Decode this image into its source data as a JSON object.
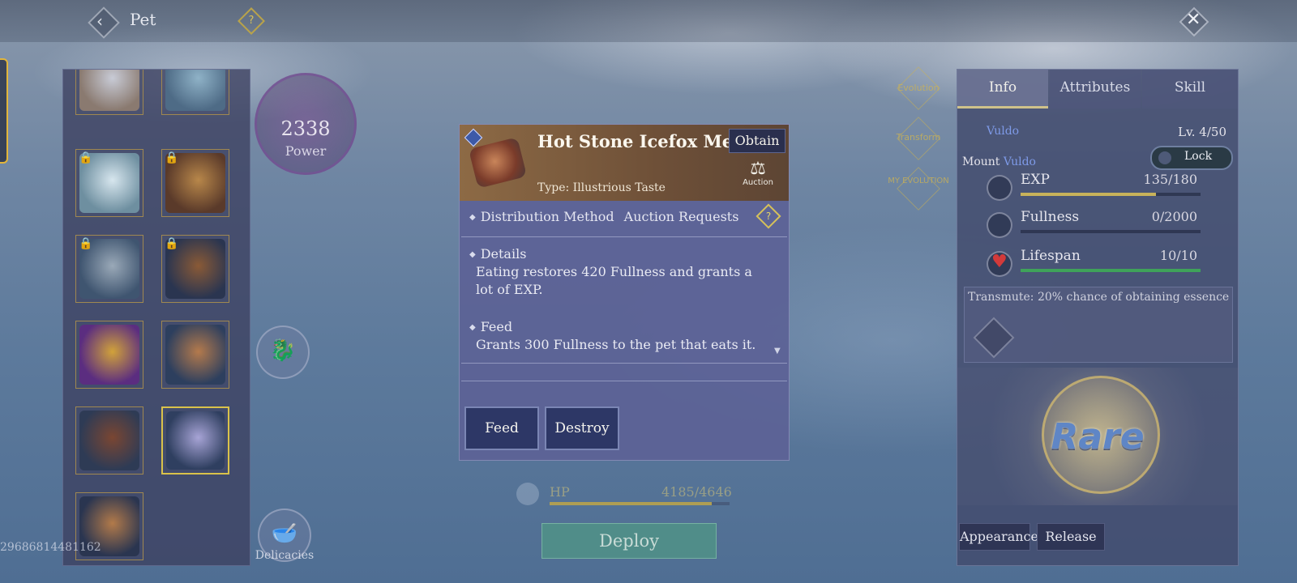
{
  "header": {
    "title": "Pet",
    "help": "?",
    "back_icon": "back-arrow-icon",
    "close_icon": "close-icon"
  },
  "power": {
    "value": "2338",
    "label": "Power"
  },
  "pet_list": {
    "slots": [
      {
        "id": "pet-1",
        "colors": [
          "#8a7a70",
          "#c8cbd6"
        ],
        "locked": false
      },
      {
        "id": "pet-2",
        "colors": [
          "#4e6b86",
          "#8fb2c7"
        ],
        "locked": false
      },
      {
        "id": "pet-3",
        "colors": [
          "#6e8fa0",
          "#d7e6ee"
        ],
        "locked": true
      },
      {
        "id": "pet-4",
        "colors": [
          "#5a3a2a",
          "#b8874a"
        ],
        "locked": true
      },
      {
        "id": "pet-5",
        "colors": [
          "#3f5570",
          "#9aa9b8"
        ],
        "locked": true
      },
      {
        "id": "pet-6",
        "colors": [
          "#2a3550",
          "#8a5a36"
        ],
        "locked": true
      },
      {
        "id": "pet-7",
        "colors": [
          "#5b2d80",
          "#d1a23a"
        ],
        "locked": false
      },
      {
        "id": "pet-8",
        "colors": [
          "#2d3f5e",
          "#b47a4c"
        ],
        "locked": false
      },
      {
        "id": "pet-9",
        "colors": [
          "#2e3b55",
          "#7a4632"
        ],
        "locked": false
      },
      {
        "id": "pet-10",
        "colors": [
          "#2f3f60",
          "#a7a4d6"
        ],
        "locked": false,
        "selected": true
      },
      {
        "id": "pet-11",
        "colors": [
          "#2a3550",
          "#b27a4a"
        ],
        "locked": false
      }
    ]
  },
  "delicacies": {
    "label": "Delicacies"
  },
  "item": {
    "name": "Hot Stone Icefox Meat",
    "obtain_label": "Obtain",
    "auction_label": "Auction",
    "type_text": "Type: Illustrious Taste",
    "distribution_label": "Distribution Method",
    "distribution_value": "Auction Requests",
    "details_title": "Details",
    "details_body": "Eating restores 420 Fullness and grants a lot of EXP.",
    "feed_title": "Feed",
    "feed_body": "Grants 300 Fullness to the pet that eats it.",
    "feed_button": "Feed",
    "destroy_button": "Destroy"
  },
  "hp": {
    "label": "HP",
    "value": "4185/4646",
    "ratio": 0.901
  },
  "deploy": {
    "label": "Deploy"
  },
  "side_actions": {
    "evolution": "Evolution",
    "transform": "Transform",
    "my_evolution": "MY EVOLUTION"
  },
  "right_panel": {
    "tabs": [
      "Info",
      "Attributes",
      "Skill"
    ],
    "active_tab": 0,
    "mount_name_top": "Vuldo",
    "level": "Lv. 4/50",
    "mount_label": "Mount",
    "mount_name": "Vuldo",
    "lock_label": "Lock",
    "stats": [
      {
        "name": "EXP",
        "value": "135/180",
        "ratio": 0.75,
        "color": "#c8b25a"
      },
      {
        "name": "Fullness",
        "value": "0/2000",
        "ratio": 0.0,
        "color": "#c8b25a"
      },
      {
        "name": "Lifespan",
        "value": "10/10",
        "ratio": 1.0,
        "color": "#3fa35a"
      }
    ],
    "transmute_text": "Transmute: 20% chance of obtaining essence",
    "rarity": "Rare",
    "appearance_button": "Appearance",
    "release_button": "Release"
  },
  "uid": "29686814481162"
}
